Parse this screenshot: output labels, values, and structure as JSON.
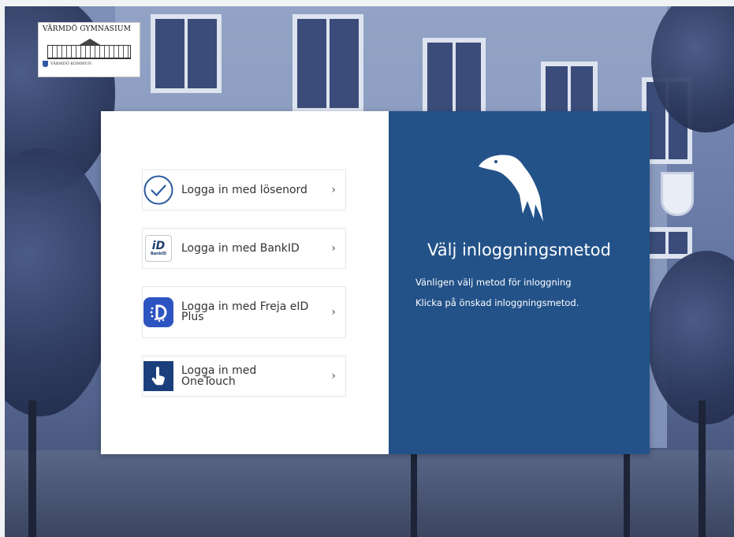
{
  "school_logo": {
    "title": "VÄRMDÖ GYMNASIUM",
    "subtitle": "VÄRMDÖ KOMMUN"
  },
  "login_options": [
    {
      "label": "Logga in med lösenord",
      "icon": "checkmark-circle-icon"
    },
    {
      "label": "Logga in med BankID",
      "icon": "bankid-icon",
      "icon_text": "BankID"
    },
    {
      "label": "Logga in med Freja eID Plus",
      "icon": "freja-eid-icon"
    },
    {
      "label": "Logga in med OneTouch",
      "icon": "onetouch-icon"
    }
  ],
  "chevron_glyph": "›",
  "info_panel": {
    "icon": "eagle-logo-icon",
    "title": "Välj inloggningsmetod",
    "line1": "Vänligen välj metod för inloggning",
    "line2": "Klicka på önskad inloggningsmetod."
  },
  "colors": {
    "panel_blue": "#235289",
    "freja_blue": "#2d55c2",
    "onetouch_blue": "#1b3f7c",
    "check_blue": "#2c5aa0"
  }
}
